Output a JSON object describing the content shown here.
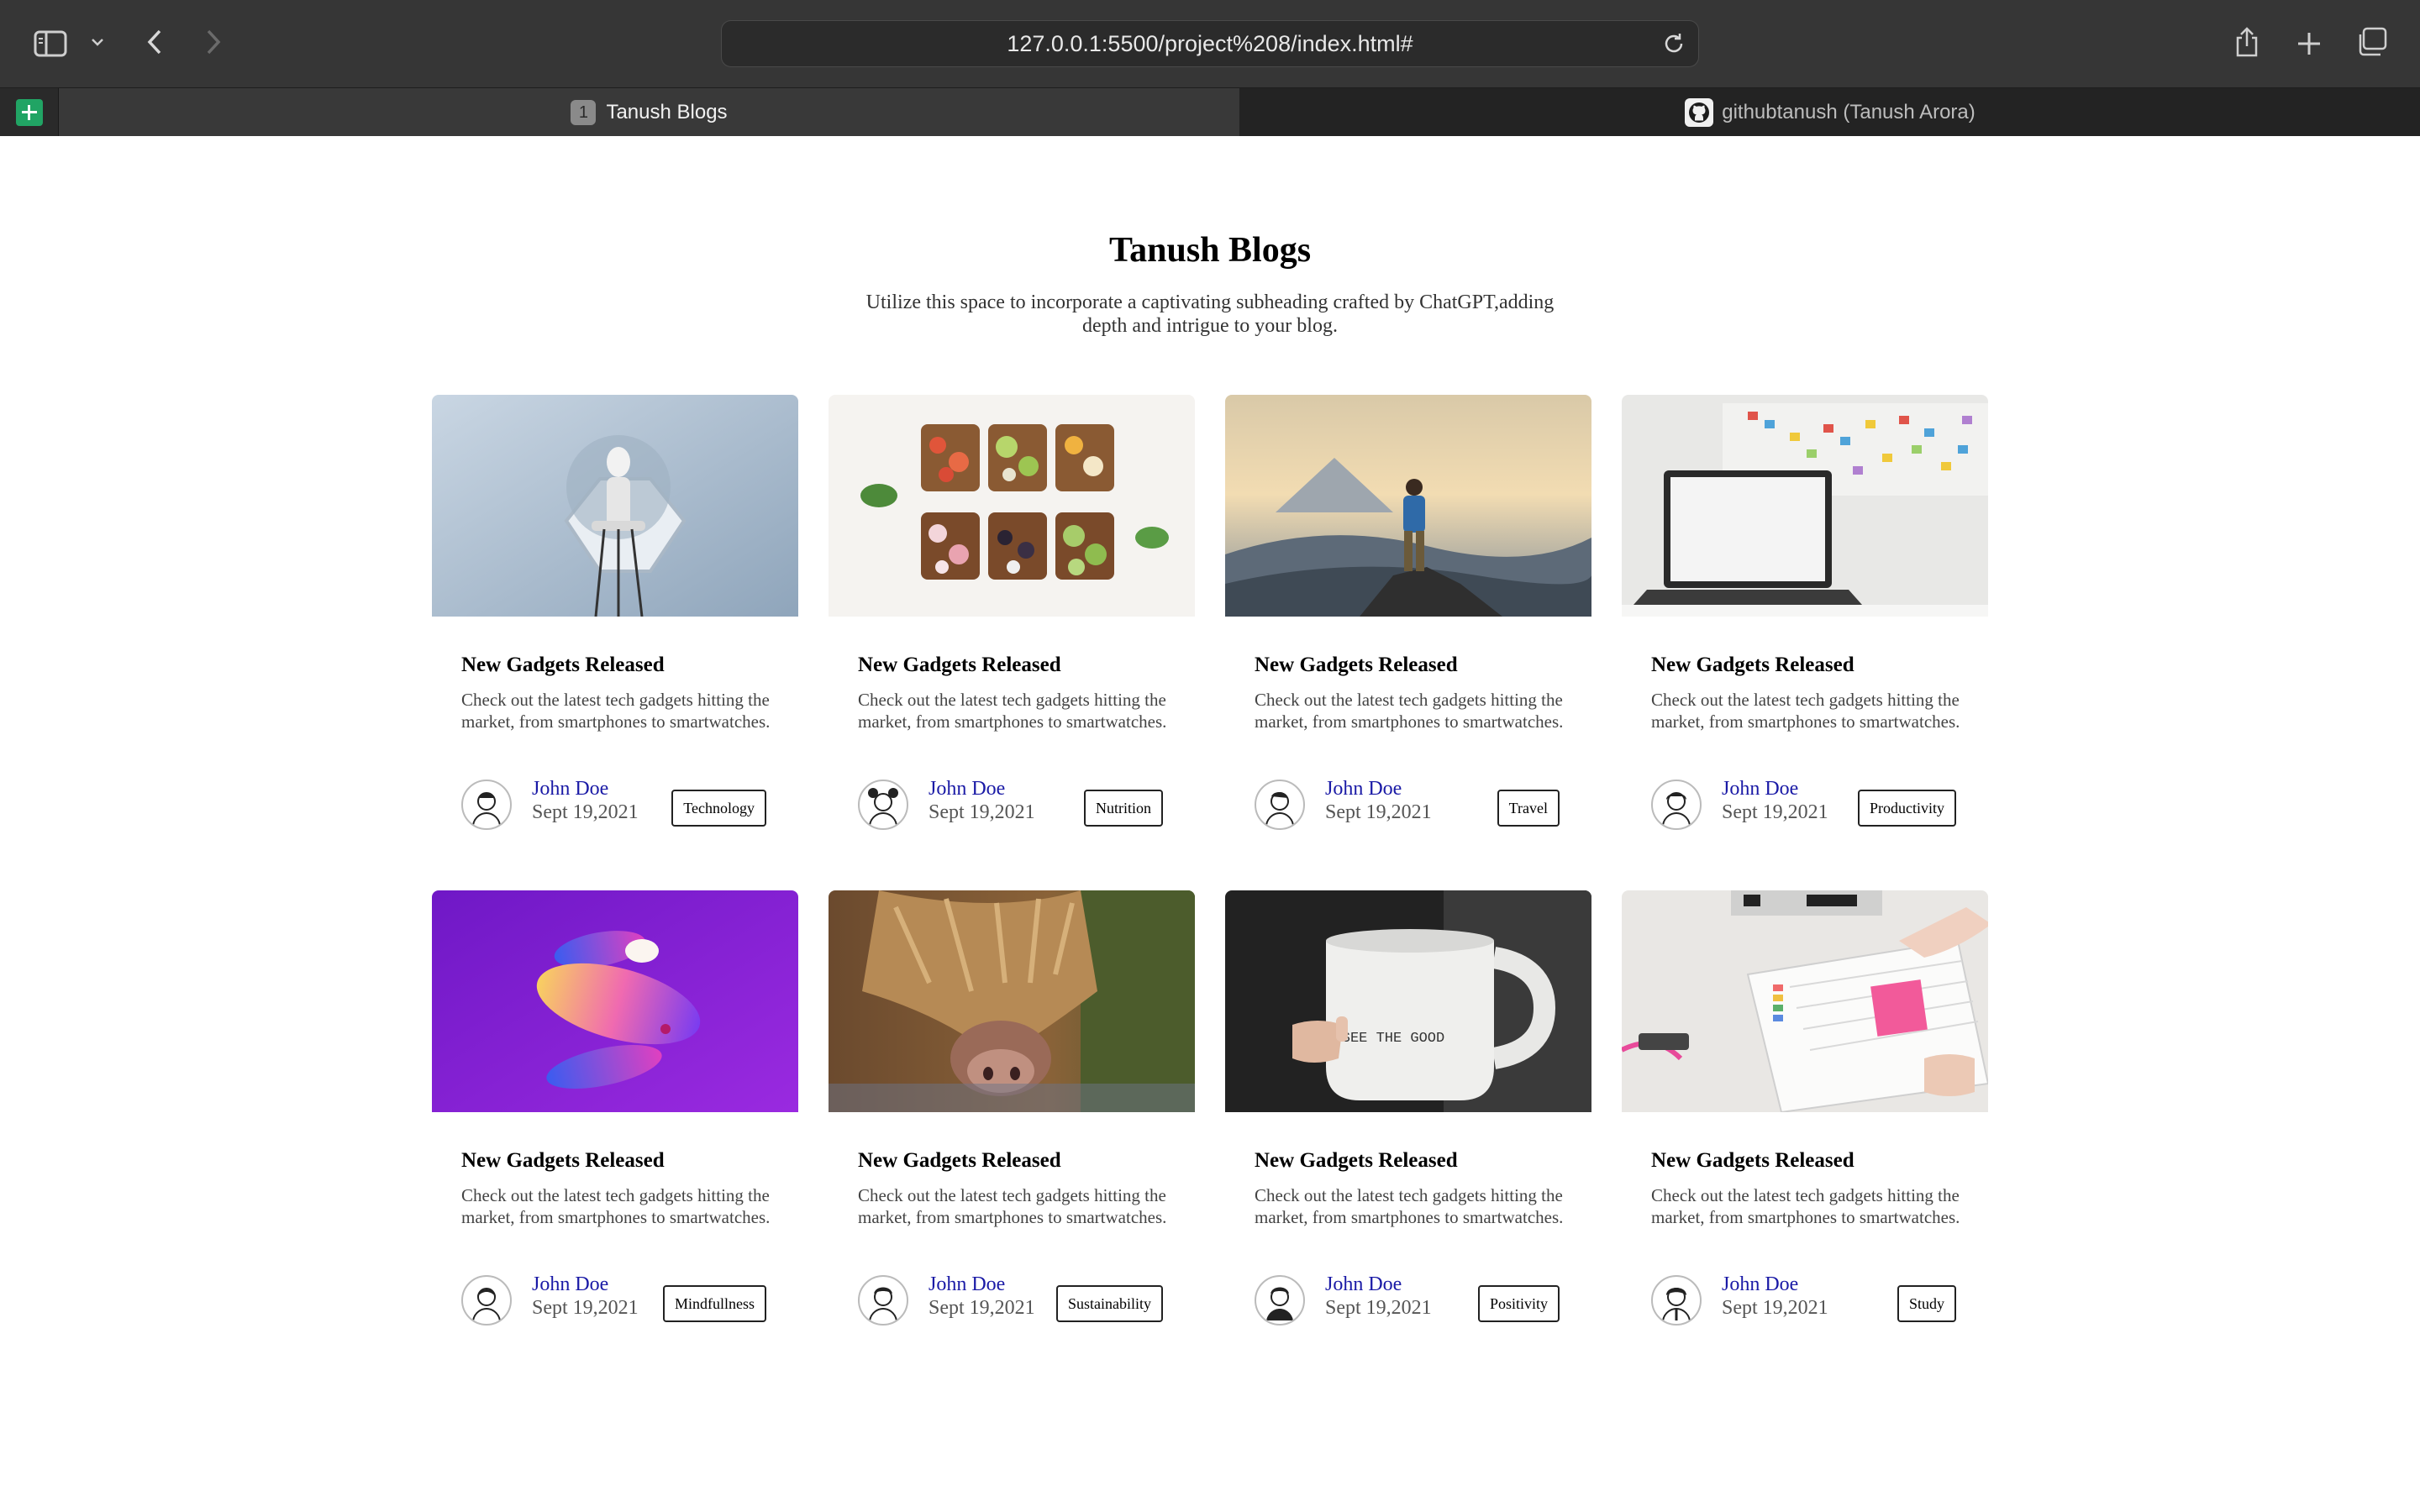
{
  "browser": {
    "url": "127.0.0.1:5500/project%208/index.html#",
    "tabs": [
      {
        "number": "1",
        "label": "Tanush Blogs"
      },
      {
        "label": "githubtanush (Tanush Arora)"
      }
    ]
  },
  "page": {
    "title": "Tanush Blogs",
    "subtitle": "Utilize this space to incorporate a captivating subheading crafted by ChatGPT,adding depth and intrigue to your blog."
  },
  "cards": [
    {
      "title": "New Gadgets Released",
      "desc": "Check out the latest tech gadgets hitting the market, from smartphones to smartwatches.",
      "author": "John Doe",
      "date": "Sept 19,2021",
      "tag": "Technology",
      "image": "robot-mirror"
    },
    {
      "title": "New Gadgets Released",
      "desc": "Check out the latest tech gadgets hitting the market, from smartphones to smartwatches.",
      "author": "John Doe",
      "date": "Sept 19,2021",
      "tag": "Nutrition",
      "image": "toasts"
    },
    {
      "title": "New Gadgets Released",
      "desc": "Check out the latest tech gadgets hitting the market, from smartphones to smartwatches.",
      "author": "John Doe",
      "date": "Sept 19,2021",
      "tag": "Travel",
      "image": "mountain-man"
    },
    {
      "title": "New Gadgets Released",
      "desc": "Check out the latest tech gadgets hitting the market, from smartphones to smartwatches.",
      "author": "John Doe",
      "date": "Sept 19,2021",
      "tag": "Productivity",
      "image": "laptop-notes"
    },
    {
      "title": "New Gadgets Released",
      "desc": "Check out the latest tech gadgets hitting the market, from smartphones to smartwatches.",
      "author": "John Doe",
      "date": "Sept 19,2021",
      "tag": "Mindfullness",
      "image": "abstract-purple"
    },
    {
      "title": "New Gadgets Released",
      "desc": "Check out the latest tech gadgets hitting the market, from smartphones to smartwatches.",
      "author": "John Doe",
      "date": "Sept 19,2021",
      "tag": "Sustainability",
      "image": "highland-cow"
    },
    {
      "title": "New Gadgets Released",
      "desc": "Check out the latest tech gadgets hitting the market, from smartphones to smartwatches.",
      "author": "John Doe",
      "date": "Sept 19,2021",
      "tag": "Positivity",
      "image": "mug-see-the-good",
      "image_text": "SEE THE GOOD"
    },
    {
      "title": "New Gadgets Released",
      "desc": "Check out the latest tech gadgets hitting the market, from smartphones to smartwatches.",
      "author": "John Doe",
      "date": "Sept 19,2021",
      "tag": "Study",
      "image": "planner-desk"
    }
  ],
  "colors": {
    "toolbar": "#363636",
    "author_link": "#1a1aa6",
    "purple": "#8b1fd6"
  }
}
